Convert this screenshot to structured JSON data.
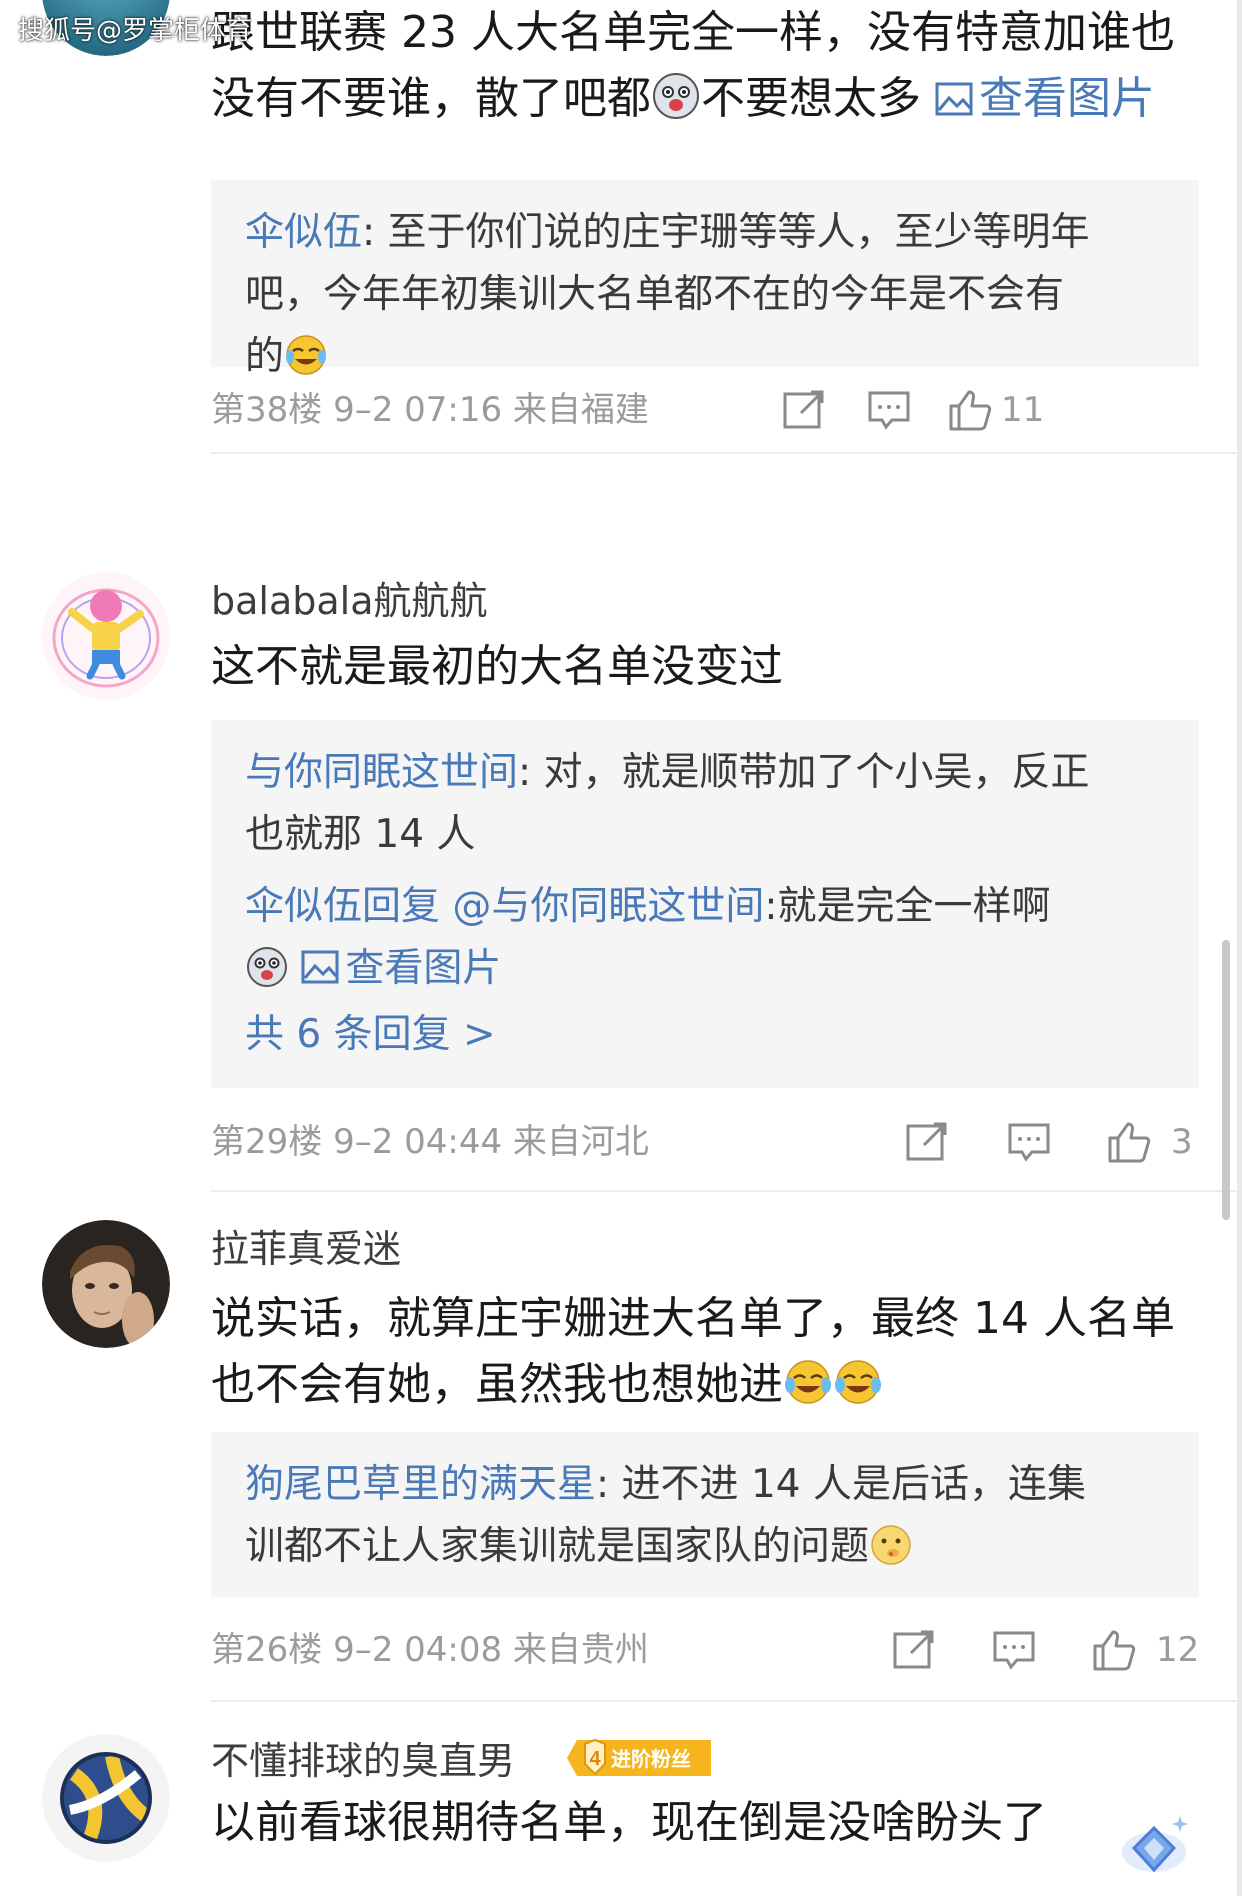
{
  "watermark": "搜狐号@罗掌柜体育",
  "comments": [
    {
      "text_line1": "跟世联赛 23 人大名单完全一样，没有特意加谁也",
      "text_line2a": "没有不要谁，散了吧都",
      "text_line2b": "不要想太多",
      "view_image": "查看图片",
      "replies": [
        {
          "name": "伞似伍",
          "text_line1": ": 至于你们说的庄宇珊等等人，至少等明年",
          "text_line2": "吧，今年年初集训大名单都不在的今年是不会有",
          "text_line3": "的"
        }
      ],
      "meta": "第38楼  9–2 07:16  来自福建",
      "likes": "11"
    },
    {
      "username": "balabala航航航",
      "text": "这不就是最初的大名单没变过",
      "replies": [
        {
          "name": "与你同眠这世间",
          "text_line1": ": 对，就是顺带加了个小吴，反正",
          "text_line2": "也就那 14 人"
        },
        {
          "name": "伞似伍回复 @与你同眠这世间",
          "text_line1": ":就是完全一样啊",
          "view_image": "查看图片"
        }
      ],
      "more_replies": "共 6 条回复 >",
      "meta": "第29楼  9–2 04:44  来自河北",
      "likes": "3"
    },
    {
      "username": "拉菲真爱迷",
      "text_line1": "说实话，就算庄宇姗进大名单了，最终 14 人名单",
      "text_line2": "也不会有她，虽然我也想她进",
      "replies": [
        {
          "name": "狗尾巴草里的满天星",
          "text_line1": ": 进不进 14 人是后话，连集",
          "text_line2": "训都不让人家集训就是国家队的问题"
        }
      ],
      "meta": "第26楼  9–2 04:08  来自贵州",
      "likes": "12"
    },
    {
      "username": "不懂排球的臭直男",
      "badge_level": "4",
      "badge_text": "进阶粉丝",
      "text": "以前看球很期待名单，现在倒是没啥盼头了"
    }
  ],
  "colors": {
    "link": "#4a79b8",
    "meta": "#9b9b9b",
    "reply_bg": "#f5f5f5",
    "badge": "#f6b51e"
  }
}
